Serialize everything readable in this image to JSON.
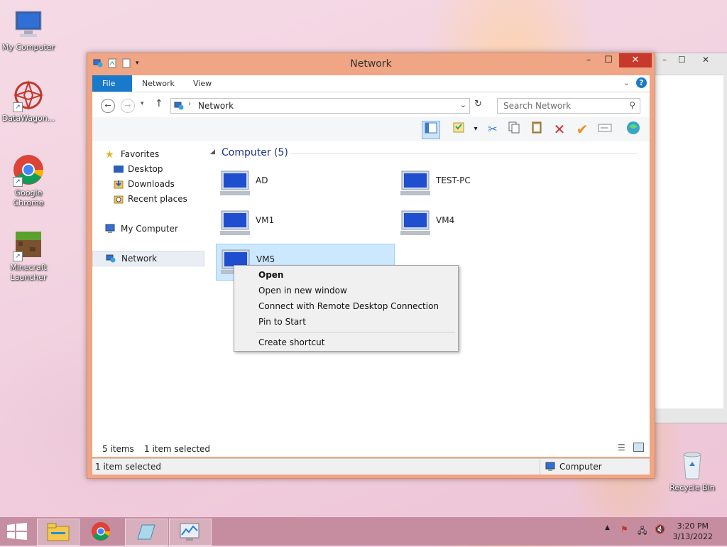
{
  "desktop": {
    "icons": [
      {
        "label": "My Computer"
      },
      {
        "label": "DataWagon..."
      },
      {
        "label": "Google Chrome"
      },
      {
        "label": "Minecraft Launcher"
      },
      {
        "label": "Recycle Bin"
      }
    ]
  },
  "window": {
    "title": "Network",
    "controls": {
      "minimize": "–",
      "maximize": "☐",
      "close": "✕"
    },
    "ribbon_tabs": [
      "File",
      "Network",
      "View"
    ],
    "address": {
      "path": "Network"
    },
    "search": {
      "placeholder": "Search Network"
    },
    "navpane": {
      "favorites": "Favorites",
      "items": [
        "Desktop",
        "Downloads",
        "Recent places"
      ],
      "my_computer": "My Computer",
      "network": "Network"
    },
    "group": {
      "header": "Computer (5)"
    },
    "computers": [
      {
        "name": "AD",
        "selected": false
      },
      {
        "name": "TEST-PC",
        "selected": false
      },
      {
        "name": "VM1",
        "selected": false
      },
      {
        "name": "VM4",
        "selected": false
      },
      {
        "name": "VM5",
        "selected": true
      }
    ],
    "status": {
      "items": "5 items",
      "selected": "1 item selected",
      "bottom_left": "1 item selected",
      "bottom_right": "Computer"
    }
  },
  "context_menu": {
    "items": [
      "Open",
      "Open in new window",
      "Connect with Remote Desktop Connection",
      "Pin to Start",
      "Create shortcut"
    ]
  },
  "taskbar": {
    "time": "3:20 PM",
    "date": "3/13/2022"
  },
  "colors": {
    "window_frame": "#f0a584",
    "close_button": "#c7392b",
    "file_tab": "#1979ca",
    "selection": "#cce8ff",
    "group_header": "#1e3287"
  }
}
